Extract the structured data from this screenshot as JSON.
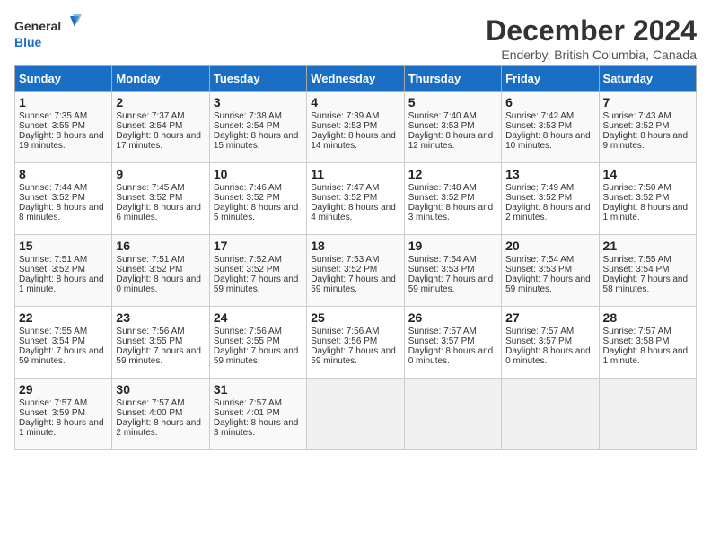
{
  "header": {
    "logo_line1": "General",
    "logo_line2": "Blue",
    "title": "December 2024",
    "subtitle": "Enderby, British Columbia, Canada"
  },
  "days_of_week": [
    "Sunday",
    "Monday",
    "Tuesday",
    "Wednesday",
    "Thursday",
    "Friday",
    "Saturday"
  ],
  "weeks": [
    [
      {
        "day": "1",
        "sunrise": "7:35 AM",
        "sunset": "3:55 PM",
        "daylight": "8 hours and 19 minutes."
      },
      {
        "day": "2",
        "sunrise": "7:37 AM",
        "sunset": "3:54 PM",
        "daylight": "8 hours and 17 minutes."
      },
      {
        "day": "3",
        "sunrise": "7:38 AM",
        "sunset": "3:54 PM",
        "daylight": "8 hours and 15 minutes."
      },
      {
        "day": "4",
        "sunrise": "7:39 AM",
        "sunset": "3:53 PM",
        "daylight": "8 hours and 14 minutes."
      },
      {
        "day": "5",
        "sunrise": "7:40 AM",
        "sunset": "3:53 PM",
        "daylight": "8 hours and 12 minutes."
      },
      {
        "day": "6",
        "sunrise": "7:42 AM",
        "sunset": "3:53 PM",
        "daylight": "8 hours and 10 minutes."
      },
      {
        "day": "7",
        "sunrise": "7:43 AM",
        "sunset": "3:52 PM",
        "daylight": "8 hours and 9 minutes."
      }
    ],
    [
      {
        "day": "8",
        "sunrise": "7:44 AM",
        "sunset": "3:52 PM",
        "daylight": "8 hours and 8 minutes."
      },
      {
        "day": "9",
        "sunrise": "7:45 AM",
        "sunset": "3:52 PM",
        "daylight": "8 hours and 6 minutes."
      },
      {
        "day": "10",
        "sunrise": "7:46 AM",
        "sunset": "3:52 PM",
        "daylight": "8 hours and 5 minutes."
      },
      {
        "day": "11",
        "sunrise": "7:47 AM",
        "sunset": "3:52 PM",
        "daylight": "8 hours and 4 minutes."
      },
      {
        "day": "12",
        "sunrise": "7:48 AM",
        "sunset": "3:52 PM",
        "daylight": "8 hours and 3 minutes."
      },
      {
        "day": "13",
        "sunrise": "7:49 AM",
        "sunset": "3:52 PM",
        "daylight": "8 hours and 2 minutes."
      },
      {
        "day": "14",
        "sunrise": "7:50 AM",
        "sunset": "3:52 PM",
        "daylight": "8 hours and 1 minute."
      }
    ],
    [
      {
        "day": "15",
        "sunrise": "7:51 AM",
        "sunset": "3:52 PM",
        "daylight": "8 hours and 1 minute."
      },
      {
        "day": "16",
        "sunrise": "7:51 AM",
        "sunset": "3:52 PM",
        "daylight": "8 hours and 0 minutes."
      },
      {
        "day": "17",
        "sunrise": "7:52 AM",
        "sunset": "3:52 PM",
        "daylight": "7 hours and 59 minutes."
      },
      {
        "day": "18",
        "sunrise": "7:53 AM",
        "sunset": "3:52 PM",
        "daylight": "7 hours and 59 minutes."
      },
      {
        "day": "19",
        "sunrise": "7:54 AM",
        "sunset": "3:53 PM",
        "daylight": "7 hours and 59 minutes."
      },
      {
        "day": "20",
        "sunrise": "7:54 AM",
        "sunset": "3:53 PM",
        "daylight": "7 hours and 59 minutes."
      },
      {
        "day": "21",
        "sunrise": "7:55 AM",
        "sunset": "3:54 PM",
        "daylight": "7 hours and 58 minutes."
      }
    ],
    [
      {
        "day": "22",
        "sunrise": "7:55 AM",
        "sunset": "3:54 PM",
        "daylight": "7 hours and 59 minutes."
      },
      {
        "day": "23",
        "sunrise": "7:56 AM",
        "sunset": "3:55 PM",
        "daylight": "7 hours and 59 minutes."
      },
      {
        "day": "24",
        "sunrise": "7:56 AM",
        "sunset": "3:55 PM",
        "daylight": "7 hours and 59 minutes."
      },
      {
        "day": "25",
        "sunrise": "7:56 AM",
        "sunset": "3:56 PM",
        "daylight": "7 hours and 59 minutes."
      },
      {
        "day": "26",
        "sunrise": "7:57 AM",
        "sunset": "3:57 PM",
        "daylight": "8 hours and 0 minutes."
      },
      {
        "day": "27",
        "sunrise": "7:57 AM",
        "sunset": "3:57 PM",
        "daylight": "8 hours and 0 minutes."
      },
      {
        "day": "28",
        "sunrise": "7:57 AM",
        "sunset": "3:58 PM",
        "daylight": "8 hours and 1 minute."
      }
    ],
    [
      {
        "day": "29",
        "sunrise": "7:57 AM",
        "sunset": "3:59 PM",
        "daylight": "8 hours and 1 minute."
      },
      {
        "day": "30",
        "sunrise": "7:57 AM",
        "sunset": "4:00 PM",
        "daylight": "8 hours and 2 minutes."
      },
      {
        "day": "31",
        "sunrise": "7:57 AM",
        "sunset": "4:01 PM",
        "daylight": "8 hours and 3 minutes."
      },
      null,
      null,
      null,
      null
    ]
  ],
  "labels": {
    "sunrise": "Sunrise:",
    "sunset": "Sunset:",
    "daylight": "Daylight:"
  }
}
